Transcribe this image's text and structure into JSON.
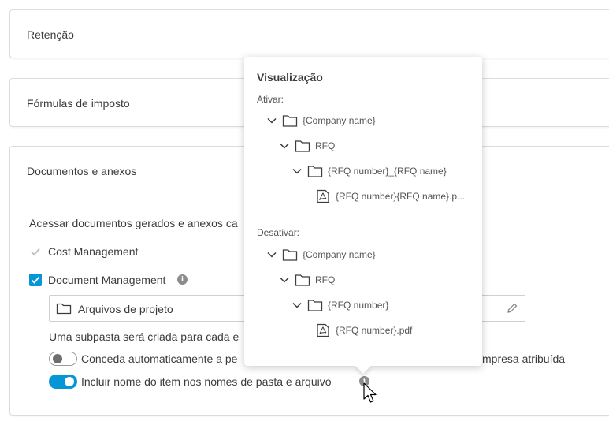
{
  "cards": {
    "retencao": "Retenção",
    "formulas": "Fórmulas de imposto",
    "documentos": "Documentos e anexos"
  },
  "docs_section": {
    "description": "Acessar documentos gerados e anexos ca",
    "cost_management": "Cost Management",
    "document_management": "Document Management",
    "folder_value": "Arquivos de projeto",
    "subfolder_note": "Uma subpasta será criada para cada e",
    "toggle1_label_left": "Conceda automaticamente a pe",
    "toggle1_label_right": "mpresa atribuída",
    "toggle2_label": "Incluir nome do item nos nomes de pasta e arquivo"
  },
  "popover": {
    "title": "Visualização",
    "enabled_label": "Ativar:",
    "disabled_label": "Desativar:",
    "enabled_tree": [
      {
        "label": "{Company name}",
        "icon": "folder-icon"
      },
      {
        "label": "RFQ",
        "icon": "folder-icon"
      },
      {
        "label": "{RFQ number}_{RFQ name}",
        "icon": "folder-icon"
      },
      {
        "label": "{RFQ number}{RFQ name}.p...",
        "icon": "pdf-file-icon"
      }
    ],
    "disabled_tree": [
      {
        "label": "{Company name}",
        "icon": "folder-icon"
      },
      {
        "label": "RFQ",
        "icon": "folder-icon"
      },
      {
        "label": "{RFQ number}",
        "icon": "folder-icon"
      },
      {
        "label": "{RFQ number}.pdf",
        "icon": "pdf-file-icon"
      }
    ]
  },
  "colors": {
    "accent": "#0696d7"
  }
}
